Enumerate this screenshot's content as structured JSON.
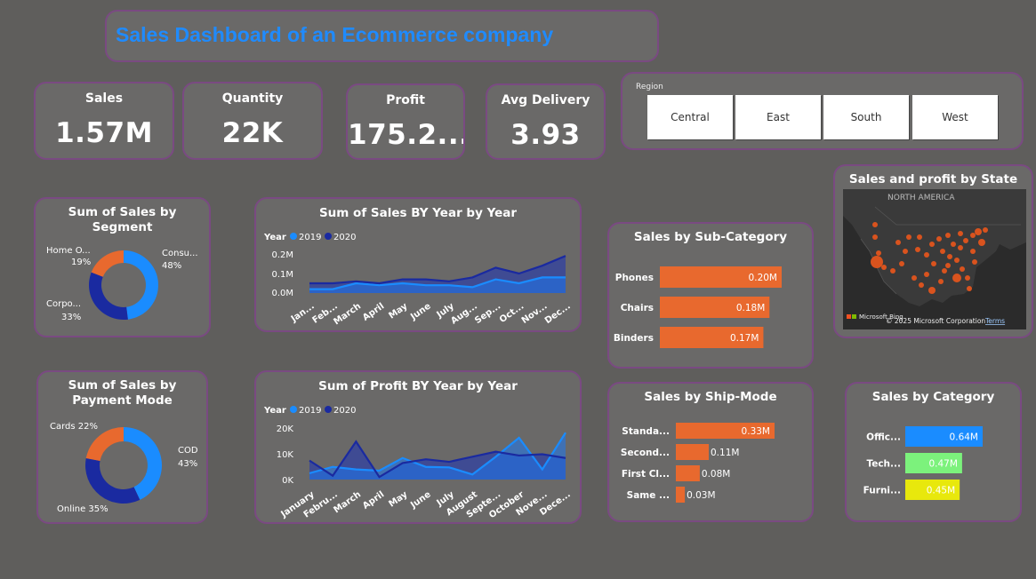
{
  "title": "Sales Dashboard of an Ecommerce company",
  "kpis": {
    "sales": {
      "label": "Sales",
      "value": "1.57M"
    },
    "quantity": {
      "label": "Quantity",
      "value": "22K"
    },
    "profit": {
      "label": "Profit",
      "value": "175.2..."
    },
    "delivery": {
      "label": "Avg Delivery",
      "value": "3.93"
    }
  },
  "region": {
    "label": "Region",
    "options": [
      "Central",
      "East",
      "South",
      "West"
    ]
  },
  "colors": {
    "y2019": "#1a8cff",
    "y2020": "#1a2aa0",
    "orange": "#e8692e",
    "green": "#7cf27c",
    "yellow": "#e8e80c"
  },
  "segment": {
    "title_line1": "Sum of Sales by",
    "title_line2": "Segment",
    "labels": {
      "home_name": "Home O...",
      "home_pct": "19%",
      "consumer_name": "Consu...",
      "consumer_pct": "48%",
      "corporate_name": "Corpo...",
      "corporate_pct": "33%"
    },
    "chart_data": {
      "type": "pie",
      "categories": [
        "Consumer",
        "Corporate",
        "Home Office"
      ],
      "values": [
        48,
        33,
        19
      ]
    }
  },
  "payment": {
    "title_line1": "Sum of Sales by",
    "title_line2": "Payment Mode",
    "labels": {
      "cards": "Cards 22%",
      "cod_name": "COD",
      "cod_pct": "43%",
      "online": "Online 35%"
    },
    "chart_data": {
      "type": "pie",
      "categories": [
        "COD",
        "Online",
        "Cards"
      ],
      "values": [
        43,
        35,
        22
      ]
    }
  },
  "sales_year": {
    "title": "Sum of Sales BY Year by Year",
    "legend_title": "Year",
    "legend": [
      "2019",
      "2020"
    ],
    "yticks": [
      "0.2M",
      "0.1M",
      "0.0M"
    ],
    "months": [
      "Jan...",
      "Feb...",
      "March",
      "April",
      "May",
      "June",
      "July",
      "Aug...",
      "Sep...",
      "Oct...",
      "Nov...",
      "Dec..."
    ],
    "chart_data": {
      "type": "area",
      "x": [
        "January",
        "February",
        "March",
        "April",
        "May",
        "June",
        "July",
        "August",
        "September",
        "October",
        "November",
        "December"
      ],
      "ylim": [
        0,
        0.2
      ],
      "series": [
        {
          "name": "2019",
          "values": [
            0.02,
            0.02,
            0.05,
            0.04,
            0.05,
            0.04,
            0.04,
            0.03,
            0.07,
            0.05,
            0.08,
            0.08
          ]
        },
        {
          "name": "2020",
          "values": [
            0.05,
            0.05,
            0.06,
            0.05,
            0.07,
            0.07,
            0.06,
            0.08,
            0.13,
            0.1,
            0.14,
            0.19
          ]
        }
      ]
    }
  },
  "profit_year": {
    "title": "Sum of Profit BY Year by Year",
    "legend_title": "Year",
    "legend": [
      "2019",
      "2020"
    ],
    "yticks": [
      "20K",
      "10K",
      "0K"
    ],
    "months": [
      "January",
      "Febru...",
      "March",
      "April",
      "May",
      "June",
      "July",
      "August",
      "Septe...",
      "October",
      "Nove...",
      "Dece..."
    ],
    "chart_data": {
      "type": "area",
      "x": [
        "January",
        "February",
        "March",
        "April",
        "May",
        "June",
        "July",
        "August",
        "September",
        "October",
        "November",
        "December"
      ],
      "ylim": [
        0,
        20000
      ],
      "series": [
        {
          "name": "2019",
          "values": [
            2500,
            5000,
            4000,
            3500,
            8500,
            5000,
            4800,
            2000,
            9000,
            16500,
            4000,
            18500
          ]
        },
        {
          "name": "2020",
          "values": [
            7500,
            1500,
            15000,
            1000,
            6500,
            8000,
            7000,
            9000,
            11000,
            9500,
            10000,
            8500
          ]
        }
      ]
    }
  },
  "subcat": {
    "title": "Sales by Sub-Category",
    "chart_data": {
      "type": "bar",
      "categories": [
        "Phones",
        "Chairs",
        "Binders"
      ],
      "values": [
        0.2,
        0.18,
        0.17
      ],
      "labels": [
        "0.20M",
        "0.18M",
        "0.17M"
      ]
    }
  },
  "shipmode": {
    "title": "Sales by Ship-Mode",
    "chart_data": {
      "type": "bar",
      "categories": [
        "Standa...",
        "Second...",
        "First Cl...",
        "Same ..."
      ],
      "values": [
        0.33,
        0.11,
        0.08,
        0.03
      ],
      "labels": [
        "0.33M",
        "0.11M",
        "0.08M",
        "0.03M"
      ]
    }
  },
  "category": {
    "title": "Sales by Category",
    "chart_data": {
      "type": "bar",
      "categories": [
        "Offic...",
        "Tech...",
        "Furni..."
      ],
      "values": [
        0.64,
        0.47,
        0.45
      ],
      "labels": [
        "0.64M",
        "0.47M",
        "0.45M"
      ]
    }
  },
  "map": {
    "title": "Sales and profit by State",
    "region_label": "NORTH AMERICA",
    "brand": "Microsoft Bing",
    "copyright": "© 2025 Microsoft Corporation",
    "terms": "Terms"
  }
}
